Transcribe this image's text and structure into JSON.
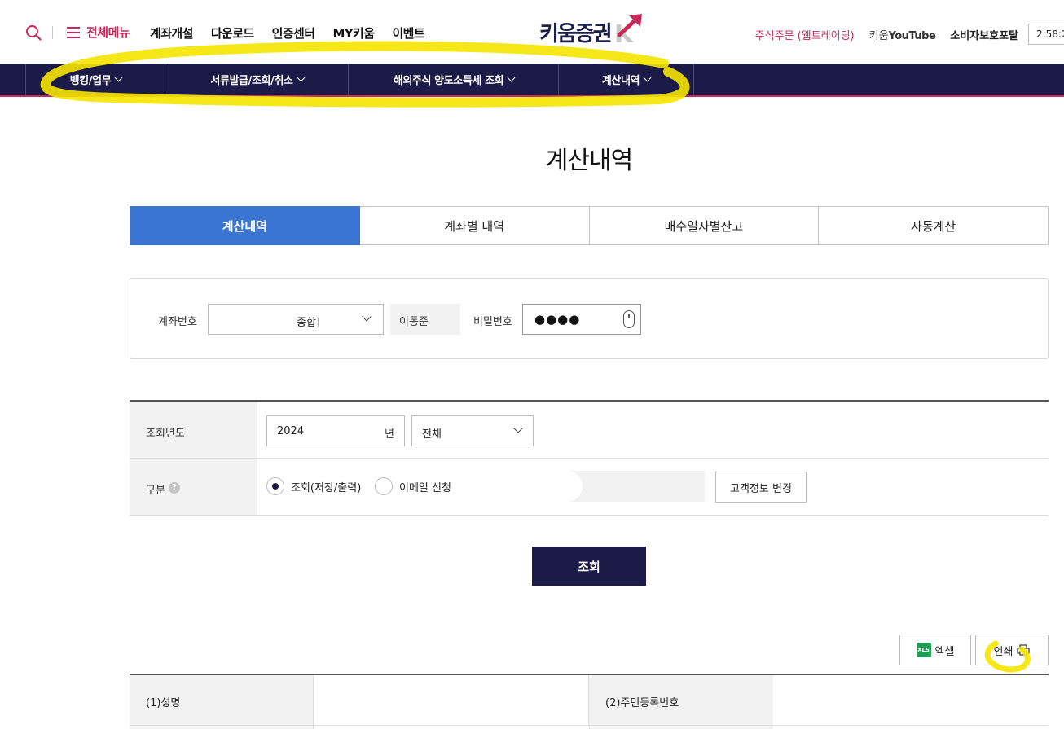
{
  "header": {
    "all_menu": "전체메뉴",
    "nav": [
      "계좌개설",
      "다운로드",
      "인증센터",
      "MY키움",
      "이벤트"
    ],
    "logo_text": "키움증권",
    "logo_mark": "K",
    "util_order": "주식주문 (웹트레이딩)",
    "util_youtube_prefix": "키움",
    "util_youtube": "YouTube",
    "util_portal": "소비자보호포탈",
    "clock": "2:58:2"
  },
  "gnb": {
    "items": [
      "뱅킹/업무",
      "서류발급/조회/취소",
      "해외주식 양도소득세 조회",
      "계산내역"
    ]
  },
  "page": {
    "title": "계산내역",
    "tabs": [
      "계산내역",
      "계좌별 내역",
      "매수일자별잔고",
      "자동계산"
    ]
  },
  "account": {
    "label": "계좌번호",
    "select_value": "종합]",
    "owner": "이동준",
    "pw_label": "비밀번호",
    "pw_value": "●●●●"
  },
  "form": {
    "year_label": "조회년도",
    "year_value": "2024",
    "year_unit": "년",
    "type_value": "전체",
    "kind_label": "구분",
    "radio_view": "조회(저장/출력)",
    "radio_email": "이메일 신청",
    "cust_button": "고객정보 변경"
  },
  "search_button": "조회",
  "export": {
    "excel_icon": "XLS",
    "excel": "엑셀",
    "print": "인쇄"
  },
  "result": {
    "name_label": "(1)성명",
    "rrn_label": "(2)주민등록번호"
  },
  "colors": {
    "brand_navy": "#1c1a46",
    "brand_pink": "#c8285a",
    "tab_active": "#3a75d4",
    "annotation": "#f5e400"
  }
}
